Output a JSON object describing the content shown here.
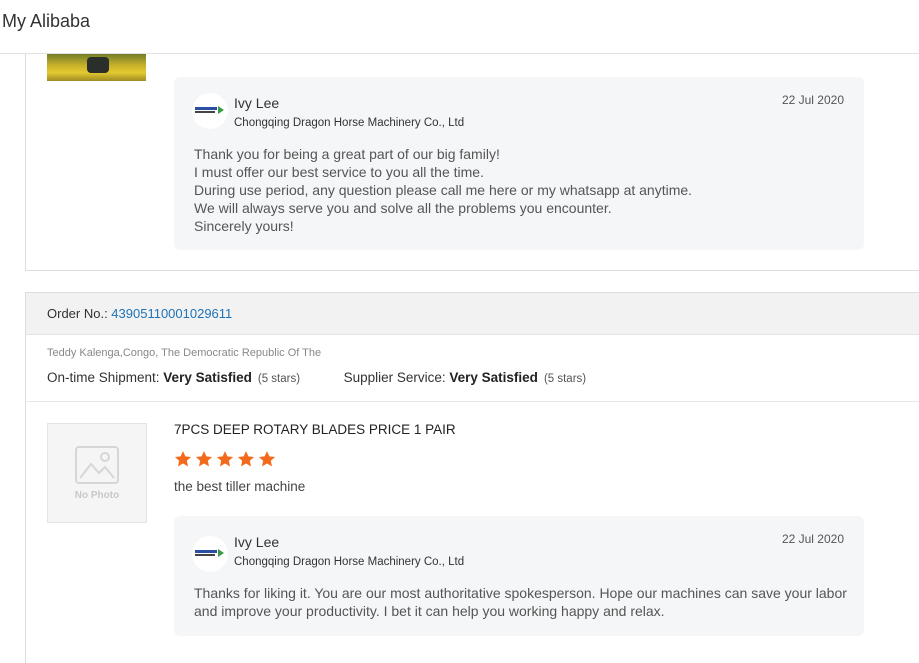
{
  "header": {
    "title": "My Alibaba"
  },
  "reviews": [
    {
      "reply": {
        "name": "Ivy Lee",
        "company": "Chongqing Dragon Horse Machinery Co., Ltd",
        "date": "22 Jul 2020",
        "lines": [
          "Thank you for being a great part of our big family!",
          "I must offer our best service to you all the time.",
          "During use period, any question please call me here or my whatsapp at anytime.",
          "We will always serve you and solve all the problems you encounter.",
          "Sincerely yours!"
        ]
      }
    },
    {
      "order_label": "Order No.: ",
      "order_number": "43905110001029611",
      "buyer": "Teddy Kalenga,Congo, The Democratic Republic Of The",
      "shipment_label": "On-time Shipment: ",
      "shipment_value": "Very Satisfied",
      "shipment_stars": "(5 stars)",
      "service_label": "Supplier Service: ",
      "service_value": "Very Satisfied",
      "service_stars": "(5 stars)",
      "product_title": "7PCS DEEP ROTARY BLADES PRICE 1 PAIR",
      "rating": 5,
      "rating_max": 5,
      "no_photo_text": "No Photo",
      "review_text": "the best tiller machine",
      "reply": {
        "name": "Ivy Lee",
        "company": "Chongqing Dragon Horse Machinery Co., Ltd",
        "date": "22 Jul 2020",
        "lines": [
          "Thanks for liking it. You are our most authoritative spokesperson. Hope our machines can save your labor",
          "and improve your productivity. I bet it can help you working happy and relax."
        ]
      }
    }
  ],
  "colors": {
    "star": "#f26b1d",
    "link": "#1f73b7",
    "reply_bg": "#f5f6f8"
  },
  "icons": {
    "star": "star-icon",
    "placeholder": "image-placeholder-icon",
    "logo": "company-logo-icon"
  }
}
